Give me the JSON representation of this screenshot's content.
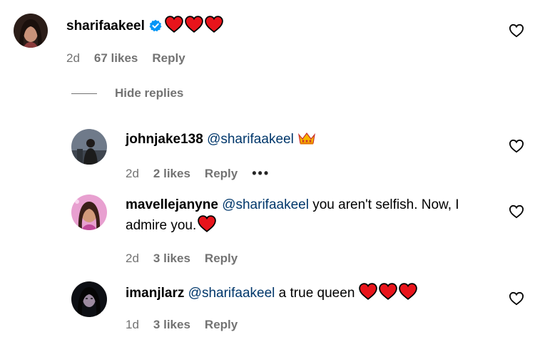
{
  "comments": {
    "main": {
      "username": "sharifaakeel",
      "verified": true,
      "text_emoji": "heart-red x3",
      "time": "2d",
      "likes": "67 likes",
      "reply": "Reply"
    },
    "hide_replies_label": "Hide replies",
    "replies": [
      {
        "username": "johnjake138",
        "mention": "@sharifaakeel",
        "emoji": "crown-icon",
        "time": "2d",
        "likes": "2 likes",
        "reply": "Reply",
        "more": "•••"
      },
      {
        "username": "mavellejanyne",
        "mention": "@sharifaakeel",
        "text_line1": " you aren't selfish. Now, I",
        "text_line2": "admire you.",
        "time": "2d",
        "likes": "3 likes",
        "reply": "Reply"
      },
      {
        "username": "imanjlarz",
        "mention": "@sharifaakeel",
        "text": " a true queen ",
        "time": "1d",
        "likes": "3 likes",
        "reply": "Reply"
      }
    ]
  },
  "colors": {
    "heart": "#e8141b",
    "mention": "#00376b",
    "muted": "#737373",
    "verified": "#0095f6"
  }
}
